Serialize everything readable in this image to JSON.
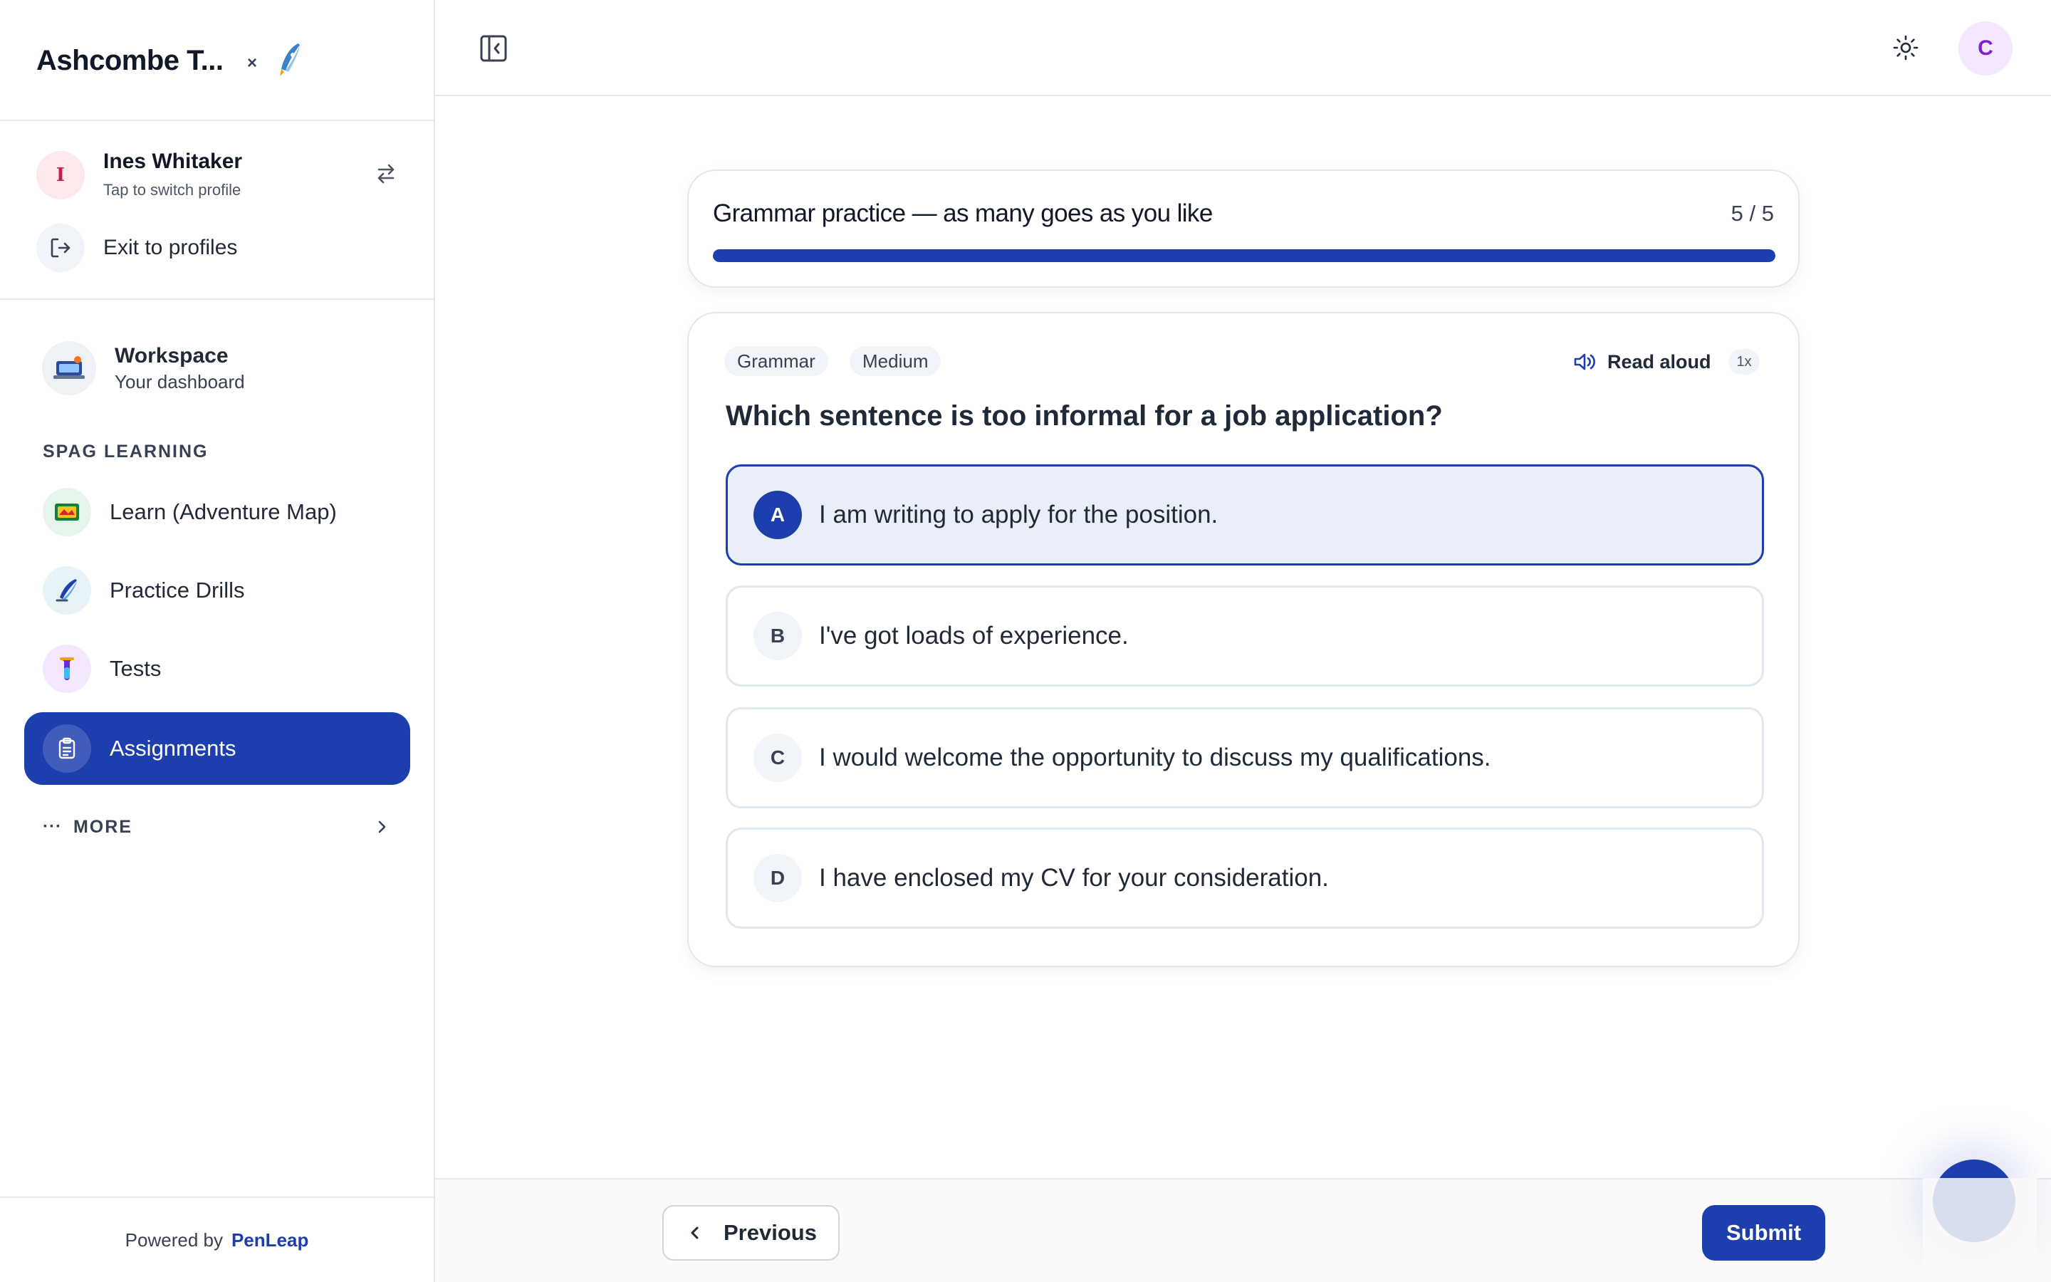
{
  "sidebar": {
    "brand_title": "Ashcombe T...",
    "brand_close": "×",
    "profile": {
      "initial": "I",
      "name": "Ines Whitaker",
      "subtitle": "Tap to switch profile"
    },
    "exit_label": "Exit to profiles",
    "workspace": {
      "title": "Workspace",
      "subtitle": "Your dashboard"
    },
    "section_label": "SPAG LEARNING",
    "nav_items": [
      {
        "label": "Learn (Adventure Map)",
        "icon": "map-icon"
      },
      {
        "label": "Practice Drills",
        "icon": "quill-icon"
      },
      {
        "label": "Tests",
        "icon": "test-tube-icon"
      },
      {
        "label": "Assignments",
        "icon": "clipboard-icon",
        "active": true
      }
    ],
    "more": {
      "dots": "···",
      "label": "MORE"
    },
    "powered_by": {
      "prefix": "Powered by",
      "brand": "PenLeap"
    }
  },
  "topbar": {
    "user_initial": "C"
  },
  "progress": {
    "title": "Grammar practice — as many goes as you like",
    "count": "5 / 5",
    "fraction": 1.0
  },
  "question": {
    "tags": [
      "Grammar",
      "Medium"
    ],
    "read_aloud_label": "Read aloud",
    "speed": "1x",
    "text": "Which sentence is too informal for a job application?",
    "options": [
      {
        "letter": "A",
        "text": "I am writing to apply for the position.",
        "selected": true
      },
      {
        "letter": "B",
        "text": "I've got loads of experience.",
        "selected": false
      },
      {
        "letter": "C",
        "text": "I would welcome the opportunity to discuss my qualifications.",
        "selected": false
      },
      {
        "letter": "D",
        "text": "I have enclosed my CV for your consideration.",
        "selected": false
      }
    ]
  },
  "footer": {
    "previous_label": "Previous",
    "submit_label": "Submit"
  },
  "colors": {
    "accent": "#1d3fae",
    "selected_bg": "#e9eef9",
    "border": "#e5e7eb"
  }
}
